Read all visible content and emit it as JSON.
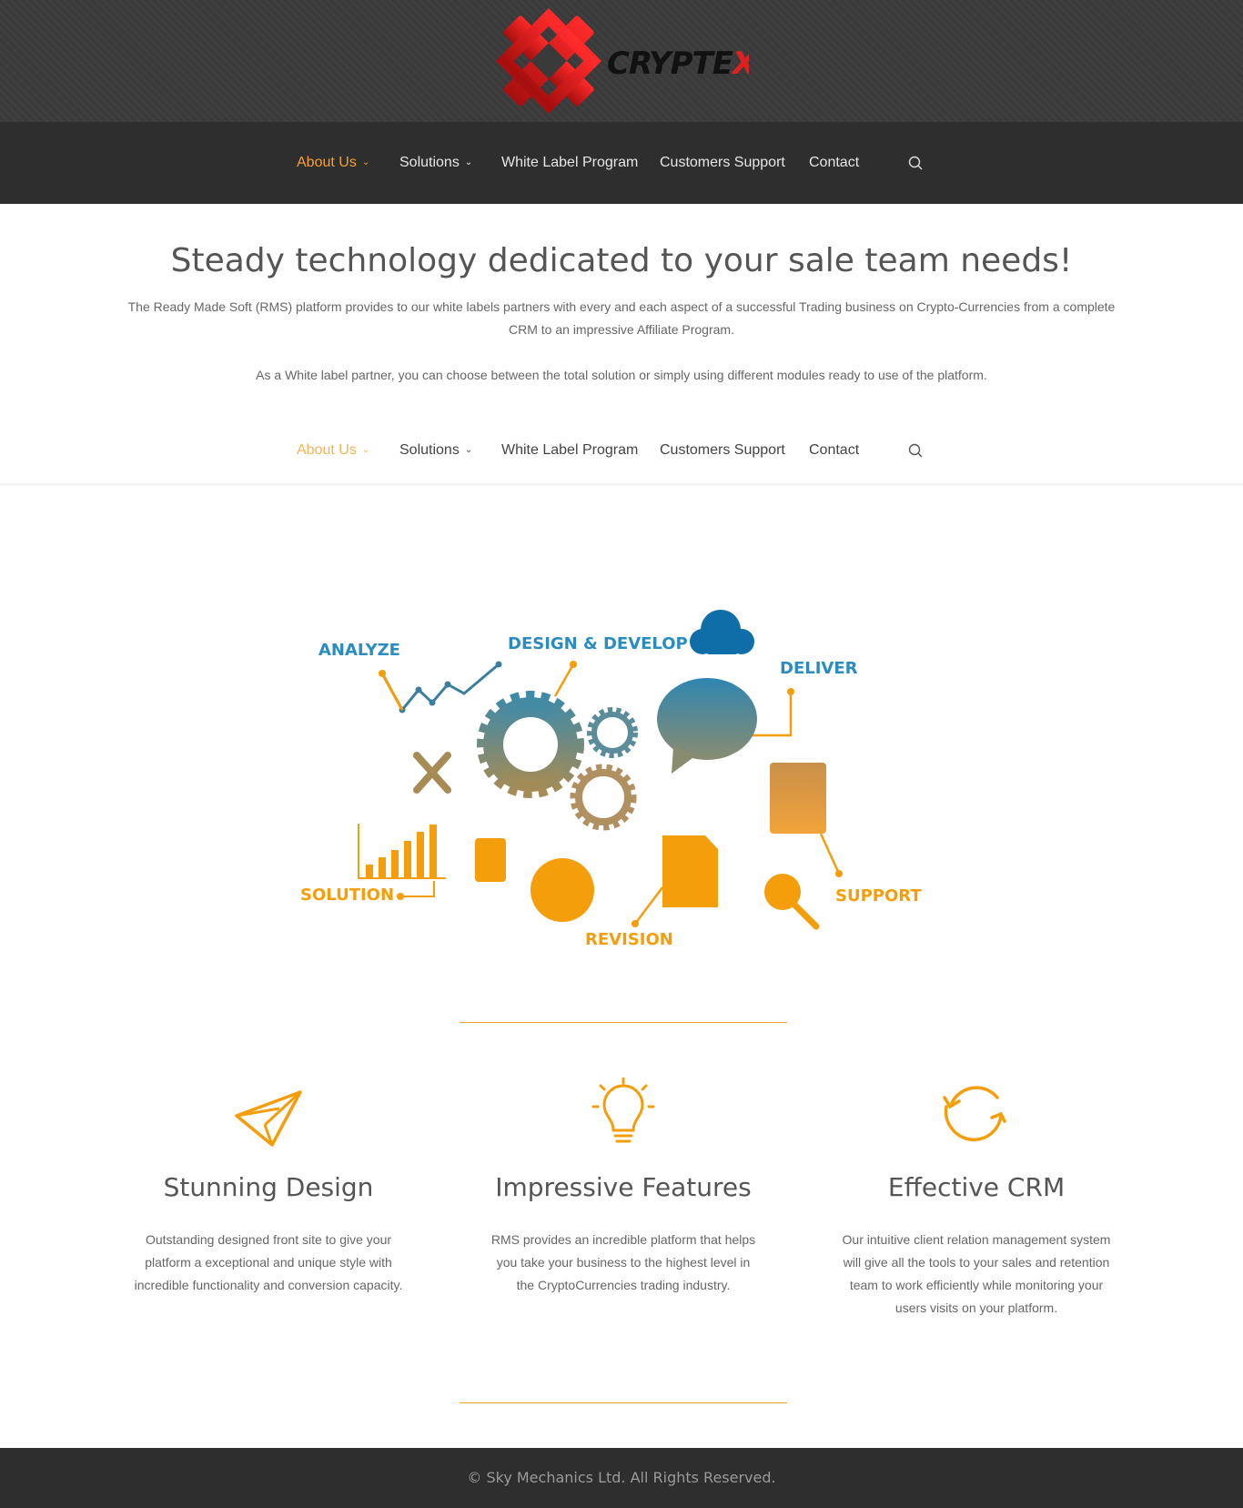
{
  "brand": {
    "logo_text": "CRYPTEX"
  },
  "nav": {
    "items": [
      {
        "label": "About Us",
        "caret": "⌄"
      },
      {
        "label": "Solutions",
        "caret": "⌄"
      },
      {
        "label": "White Label Program"
      },
      {
        "label": "Customers Support"
      },
      {
        "label": "Contact"
      }
    ],
    "search_icon": "search-icon"
  },
  "hero": {
    "title": "Steady technology dedicated to your sale team needs!",
    "paragraph1": "The Ready Made Soft (RMS) platform provides to our white labels partners with every and each aspect of a successful Trading business on Crypto-Currencies from a complete CRM to an impressive Affiliate Program.",
    "paragraph2": "As a White label partner, you can choose between the total solution or simply using different modules ready to use of the platform."
  },
  "graphic": {
    "labels": {
      "analyze": "ANALYZE",
      "design": "DESIGN & DEVELOP",
      "deliver": "DELIVER",
      "solution": "SOLUTION",
      "revision": "REVISION",
      "support": "SUPPORT"
    },
    "colors": {
      "blue": "#2a8cc0",
      "orange": "#f59e0b"
    }
  },
  "features": [
    {
      "icon": "paper-plane-icon",
      "title": "Stunning Design",
      "text": "Outstanding designed front site to give your platform a exceptional and unique style with incredible functionality and conversion capacity."
    },
    {
      "icon": "lightbulb-icon",
      "title": "Impressive Features",
      "text": "RMS provides an incredible platform that helps you take your business to the highest level in the CryptoCurrencies trading industry."
    },
    {
      "icon": "refresh-icon",
      "title": "Effective CRM",
      "text": "Our intuitive client relation management system will give all the tools to your sales and retention team to work efficiently while monitoring your users visits on your platform."
    }
  ],
  "footer": {
    "copyright": "© Sky Mechanics Ltd. All Rights Reserved."
  },
  "colors": {
    "accent": "#f5a031",
    "dark": "#2e2e2e",
    "logo_red": "#e02020"
  }
}
